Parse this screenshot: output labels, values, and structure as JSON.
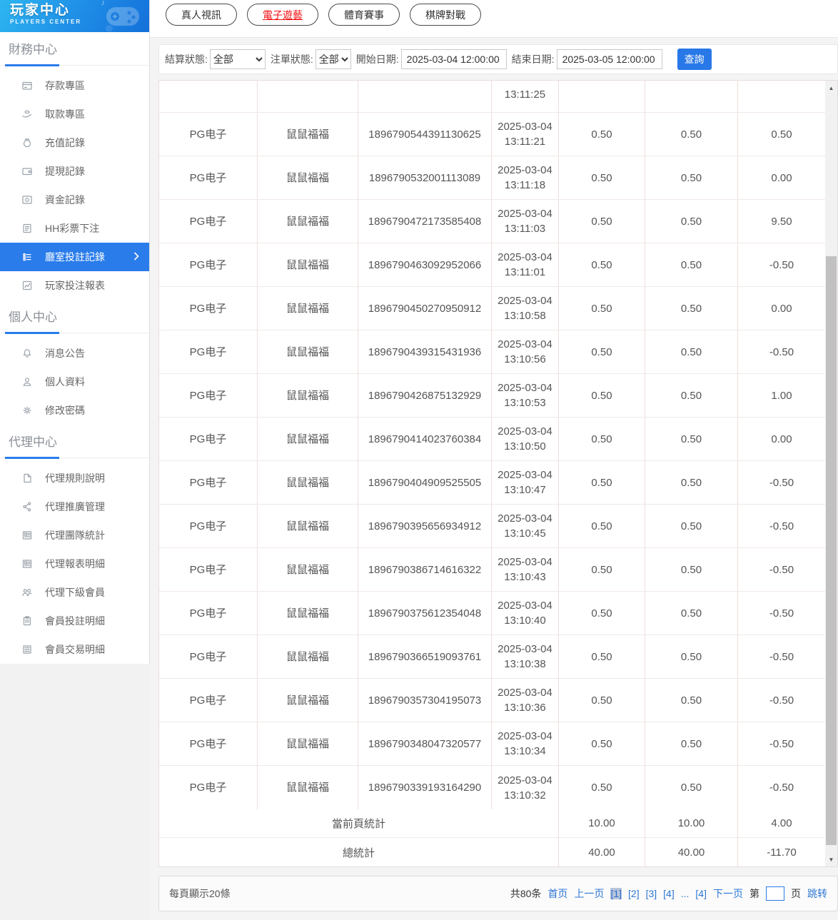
{
  "logo": {
    "title": "玩家中心",
    "subtitle": "PLAYERS CENTER"
  },
  "sidebar": {
    "sections": [
      {
        "title": "財務中心",
        "items": [
          {
            "label": "存款專區"
          },
          {
            "label": "取款專區"
          },
          {
            "label": "充值記錄"
          },
          {
            "label": "提現記錄"
          },
          {
            "label": "資金記錄"
          },
          {
            "label": "HH彩票下注"
          },
          {
            "label": "廳室投註記錄",
            "active": true
          },
          {
            "label": "玩家投注報表"
          }
        ]
      },
      {
        "title": "個人中心",
        "items": [
          {
            "label": "消息公告"
          },
          {
            "label": "個人資料"
          },
          {
            "label": "修改密碼"
          }
        ]
      },
      {
        "title": "代理中心",
        "items": [
          {
            "label": "代理規則說明"
          },
          {
            "label": "代理推廣管理"
          },
          {
            "label": "代理團隊統計"
          },
          {
            "label": "代理報表明細"
          },
          {
            "label": "代理下級會員"
          },
          {
            "label": "會員投註明細"
          },
          {
            "label": "會員交易明細"
          }
        ]
      }
    ]
  },
  "tabs": [
    {
      "label": "真人視訊",
      "active": false
    },
    {
      "label": "電子遊藝",
      "active": true
    },
    {
      "label": "體育賽事",
      "active": false
    },
    {
      "label": "棋牌對戰",
      "active": false
    }
  ],
  "filters": {
    "settle_status_label": "結算狀態:",
    "settle_status_value": "全部",
    "bet_status_label": "注單狀態:",
    "bet_status_value": "全部",
    "start_date_label": "開始日期:",
    "start_date_value": "2025-03-04 12:00:00",
    "end_date_label": "結束日期:",
    "end_date_value": "2025-03-05 12:00:00",
    "search_button": "查詢"
  },
  "table": {
    "partial_row_time": "13:11:25",
    "rows": [
      {
        "provider": "PG电子",
        "game": "鼠鼠福福",
        "id": "1896790544391130625",
        "date": "2025-03-04",
        "time": "13:11:21",
        "bet": "0.50",
        "valid": "0.50",
        "winloss": "0.50"
      },
      {
        "provider": "PG电子",
        "game": "鼠鼠福福",
        "id": "1896790532001113089",
        "date": "2025-03-04",
        "time": "13:11:18",
        "bet": "0.50",
        "valid": "0.50",
        "winloss": "0.00"
      },
      {
        "provider": "PG电子",
        "game": "鼠鼠福福",
        "id": "1896790472173585408",
        "date": "2025-03-04",
        "time": "13:11:03",
        "bet": "0.50",
        "valid": "0.50",
        "winloss": "9.50"
      },
      {
        "provider": "PG电子",
        "game": "鼠鼠福福",
        "id": "1896790463092952066",
        "date": "2025-03-04",
        "time": "13:11:01",
        "bet": "0.50",
        "valid": "0.50",
        "winloss": "-0.50"
      },
      {
        "provider": "PG电子",
        "game": "鼠鼠福福",
        "id": "1896790450270950912",
        "date": "2025-03-04",
        "time": "13:10:58",
        "bet": "0.50",
        "valid": "0.50",
        "winloss": "0.00"
      },
      {
        "provider": "PG电子",
        "game": "鼠鼠福福",
        "id": "1896790439315431936",
        "date": "2025-03-04",
        "time": "13:10:56",
        "bet": "0.50",
        "valid": "0.50",
        "winloss": "-0.50"
      },
      {
        "provider": "PG电子",
        "game": "鼠鼠福福",
        "id": "1896790426875132929",
        "date": "2025-03-04",
        "time": "13:10:53",
        "bet": "0.50",
        "valid": "0.50",
        "winloss": "1.00"
      },
      {
        "provider": "PG电子",
        "game": "鼠鼠福福",
        "id": "1896790414023760384",
        "date": "2025-03-04",
        "time": "13:10:50",
        "bet": "0.50",
        "valid": "0.50",
        "winloss": "0.00"
      },
      {
        "provider": "PG电子",
        "game": "鼠鼠福福",
        "id": "1896790404909525505",
        "date": "2025-03-04",
        "time": "13:10:47",
        "bet": "0.50",
        "valid": "0.50",
        "winloss": "-0.50"
      },
      {
        "provider": "PG电子",
        "game": "鼠鼠福福",
        "id": "1896790395656934912",
        "date": "2025-03-04",
        "time": "13:10:45",
        "bet": "0.50",
        "valid": "0.50",
        "winloss": "-0.50"
      },
      {
        "provider": "PG电子",
        "game": "鼠鼠福福",
        "id": "1896790386714616322",
        "date": "2025-03-04",
        "time": "13:10:43",
        "bet": "0.50",
        "valid": "0.50",
        "winloss": "-0.50"
      },
      {
        "provider": "PG电子",
        "game": "鼠鼠福福",
        "id": "1896790375612354048",
        "date": "2025-03-04",
        "time": "13:10:40",
        "bet": "0.50",
        "valid": "0.50",
        "winloss": "-0.50"
      },
      {
        "provider": "PG电子",
        "game": "鼠鼠福福",
        "id": "1896790366519093761",
        "date": "2025-03-04",
        "time": "13:10:38",
        "bet": "0.50",
        "valid": "0.50",
        "winloss": "-0.50"
      },
      {
        "provider": "PG电子",
        "game": "鼠鼠福福",
        "id": "1896790357304195073",
        "date": "2025-03-04",
        "time": "13:10:36",
        "bet": "0.50",
        "valid": "0.50",
        "winloss": "-0.50"
      },
      {
        "provider": "PG电子",
        "game": "鼠鼠福福",
        "id": "1896790348047320577",
        "date": "2025-03-04",
        "time": "13:10:34",
        "bet": "0.50",
        "valid": "0.50",
        "winloss": "-0.50"
      },
      {
        "provider": "PG电子",
        "game": "鼠鼠福福",
        "id": "1896790339193164290",
        "date": "2025-03-04",
        "time": "13:10:32",
        "bet": "0.50",
        "valid": "0.50",
        "winloss": "-0.50"
      }
    ],
    "page_summary": {
      "label": "當前頁統計",
      "bet": "10.00",
      "valid": "10.00",
      "winloss": "4.00"
    },
    "total_summary": {
      "label": "總統計",
      "bet": "40.00",
      "valid": "40.00",
      "winloss": "-11.70"
    }
  },
  "pagination": {
    "page_size_text": "每頁顯示20條",
    "total_text": "共80条",
    "first": "首页",
    "prev": "上一页",
    "pages": [
      "[1]",
      "[2]",
      "[3]",
      "[4]"
    ],
    "ellipsis": "...",
    "last_page": "[4]",
    "next": "下一页",
    "jump_prefix": "第",
    "jump_suffix": "页",
    "jump_button": "跳转"
  },
  "colors": {
    "accent_blue": "#2a7ceb",
    "link_blue": "#2e77d4",
    "active_tab_red": "#f20d0d"
  }
}
